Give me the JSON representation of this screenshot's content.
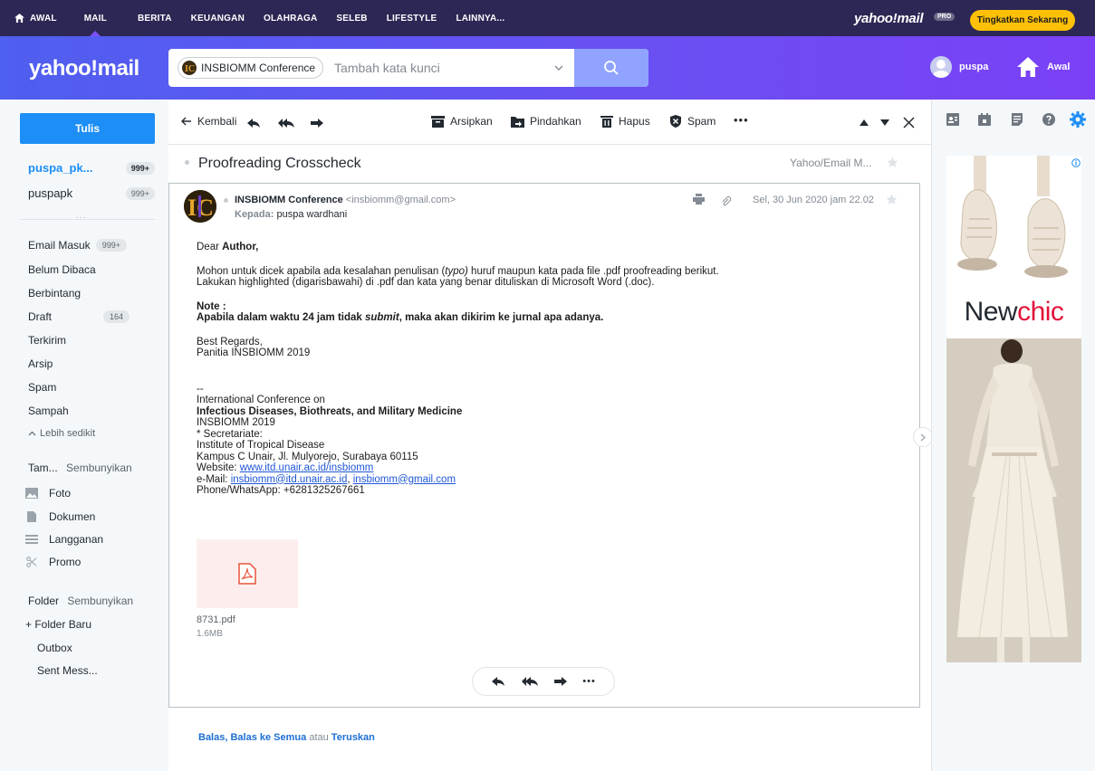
{
  "topnav": {
    "links": [
      "AWAL",
      "MAIL",
      "BERITA",
      "KEUANGAN",
      "OLAHRAGA",
      "SELEB",
      "LIFESTYLE",
      "LAINNYA..."
    ],
    "logo": "yahoo!mail",
    "pro": "PRO",
    "upgrade": "Tingkatkan Sekarang"
  },
  "header": {
    "brand": "yahoo!mail",
    "search_chip": "INSBIOMM Conference",
    "search_placeholder": "Tambah kata kunci",
    "user": "puspa",
    "home": "Awal"
  },
  "sidebar": {
    "compose": "Tulis",
    "accounts": [
      {
        "name": "puspa_pk...",
        "count": "999+"
      },
      {
        "name": "puspapk",
        "count": "999+"
      }
    ],
    "dots": "···",
    "folders": [
      {
        "label": "Email Masuk",
        "count": "999+"
      },
      {
        "label": "Belum Dibaca",
        "count": ""
      },
      {
        "label": "Berbintang",
        "count": ""
      },
      {
        "label": "Draft",
        "count": "164"
      },
      {
        "label": "Terkirim",
        "count": ""
      },
      {
        "label": "Arsip",
        "count": ""
      },
      {
        "label": "Spam",
        "count": ""
      },
      {
        "label": "Sampah",
        "count": ""
      }
    ],
    "less": "Lebih sedikit",
    "views_head": "Tam...",
    "views_hide": "Sembunyikan",
    "views": [
      "Foto",
      "Dokumen",
      "Langganan",
      "Promo"
    ],
    "folder_head": "Folder",
    "folder_hide": "Sembunyikan",
    "new_folder": "+ Folder Baru",
    "custom": [
      "Outbox",
      "Sent Mess..."
    ]
  },
  "toolbar": {
    "back": "Kembali",
    "archive": "Arsipkan",
    "move": "Pindahkan",
    "delete": "Hapus",
    "spam": "Spam",
    "more": "•••"
  },
  "message": {
    "subject": "Proofreading Crosscheck",
    "folder": "Yahoo/Email M...",
    "sender_name": "INSBIOMM Conference",
    "sender_email": "<insbiomm@gmail.com>",
    "to_label": "Kepada:",
    "to": "puspa wardhani",
    "date": "Sel, 30 Jun 2020 jam 22.02",
    "greeting_pre": "Dear ",
    "greeting_bold": "Author,",
    "p1_pre": "Mohon untuk dicek apabila ada kesalahan penulisan (",
    "p1_em": "typo)",
    "p1_post": " huruf maupun kata pada file .pdf proofreading berikut.",
    "p2": "Lakukan highlighted (digarisbawahi) di .pdf dan kata yang benar dituliskan di Microsoft Word (.doc).",
    "note": "Note :",
    "warn_pre": "Apabila dalam waktu 24 jam tidak ",
    "warn_em": "submit",
    "warn_post": ", maka akan dikirim ke jurnal apa adanya.",
    "regards": "Best Regards,",
    "committee": "Panitia INSBIOMM 2019",
    "sig_dash": "--",
    "sig1": "International Conference on",
    "sig2": "Infectious Diseases, Biothreats, and Military Medicine",
    "sig3": "INSBIOMM 2019",
    "sig4": "* Secretariate:",
    "sig5": "Institute of Tropical Disease",
    "sig6": "Kampus C Unair, Jl. Mulyorejo, Surabaya 60115",
    "sig_web_label": "Website: ",
    "sig_web": "www.itd.unair.ac.id/insbiomm",
    "sig_mail_label": "e-Mail: ",
    "sig_mail1": "insbiomm@itd.unair.ac.id",
    "sig_mail_sep": ", ",
    "sig_mail2": "insbiomm@gmail.com",
    "sig_phone": "Phone/WhatsApp: +6281325267661",
    "attachment_name": "8731.pdf",
    "attachment_size": "1.6MB",
    "pill_more": "•••"
  },
  "reply_line": {
    "reply": "Balas,",
    "reply_all": "Balas ke Semua",
    "or": " atau ",
    "forward": "Teruskan"
  },
  "ad": {
    "brand_a": "New",
    "brand_b": "chic"
  },
  "colors": {
    "accent": "#1d8ef6",
    "nav": "#2d2755",
    "upgrade": "#ffc107"
  }
}
